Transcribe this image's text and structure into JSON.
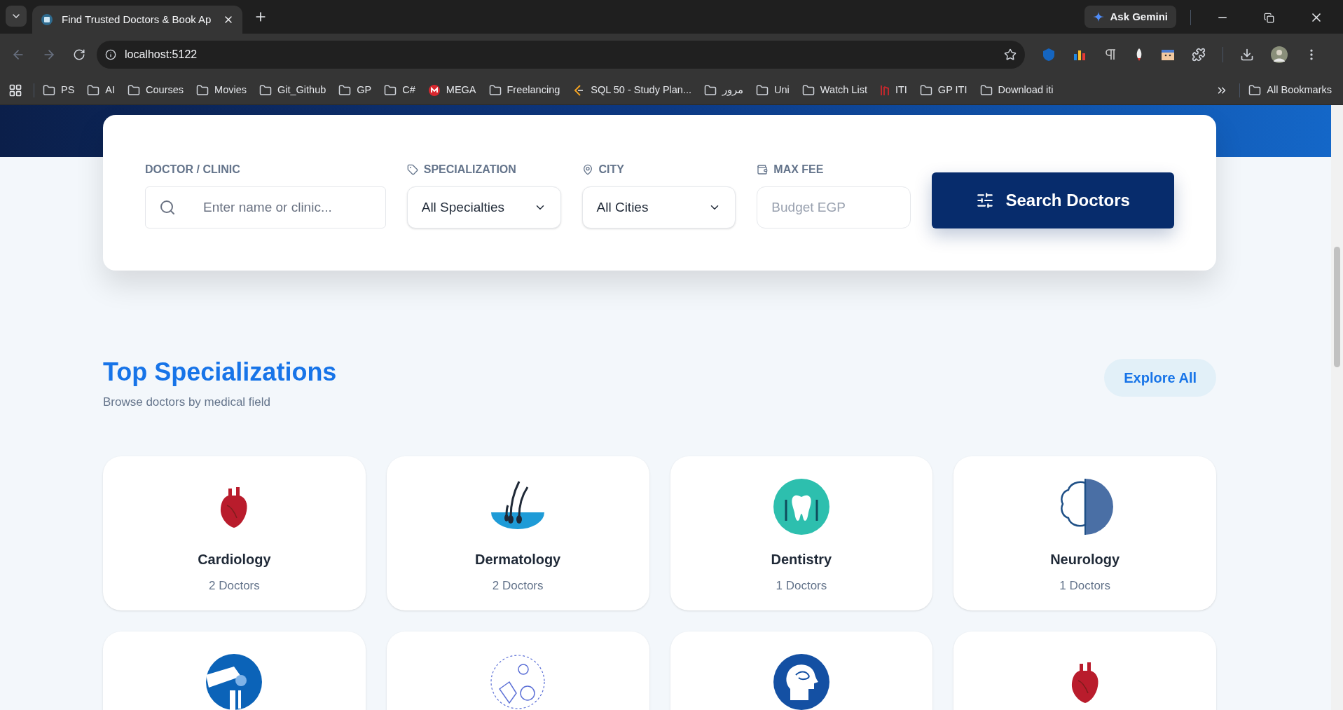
{
  "browser": {
    "tab_title": "Find Trusted Doctors & Book Ap",
    "url": "localhost:5122",
    "ask_button": "Ask Gemini",
    "bookmarks": [
      {
        "label": "PS",
        "kind": "folder"
      },
      {
        "label": "AI",
        "kind": "folder"
      },
      {
        "label": "Courses",
        "kind": "folder"
      },
      {
        "label": "Movies",
        "kind": "folder"
      },
      {
        "label": "Git_Github",
        "kind": "folder"
      },
      {
        "label": "GP",
        "kind": "folder"
      },
      {
        "label": "C#",
        "kind": "folder"
      },
      {
        "label": "MEGA",
        "kind": "mega"
      },
      {
        "label": "Freelancing",
        "kind": "folder"
      },
      {
        "label": "SQL 50 - Study Plan...",
        "kind": "code"
      },
      {
        "label": "مرور",
        "kind": "folder"
      },
      {
        "label": "Uni",
        "kind": "folder"
      },
      {
        "label": "Watch List",
        "kind": "folder"
      },
      {
        "label": "ITI",
        "kind": "iti"
      },
      {
        "label": "GP ITI",
        "kind": "folder"
      },
      {
        "label": "Download iti",
        "kind": "folder"
      }
    ],
    "all_bookmarks": "All Bookmarks"
  },
  "search": {
    "fields": [
      {
        "label": "DOCTOR / CLINIC",
        "kind": "text",
        "placeholder": "Enter name or clinic..."
      },
      {
        "label": "SPECIALIZATION",
        "kind": "select",
        "value": "All Specialties"
      },
      {
        "label": "CITY",
        "kind": "select",
        "value": "All Cities"
      },
      {
        "label": "MAX FEE",
        "kind": "number",
        "placeholder": "Budget EGP"
      }
    ],
    "button": "Search Doctors"
  },
  "specializations": {
    "title": "Top Specializations",
    "subtitle": "Browse doctors by medical field",
    "explore": "Explore All",
    "cards": [
      {
        "kind": "heart",
        "name": "Cardiology",
        "count": "2 Doctors"
      },
      {
        "kind": "hair",
        "name": "Dermatology",
        "count": "2 Doctors"
      },
      {
        "kind": "tooth",
        "name": "Dentistry",
        "count": "1 Doctors"
      },
      {
        "kind": "brain",
        "name": "Neurology",
        "count": "1 Doctors"
      },
      {
        "kind": "knee"
      },
      {
        "kind": "child"
      },
      {
        "kind": "head"
      },
      {
        "kind": "heart"
      }
    ]
  }
}
